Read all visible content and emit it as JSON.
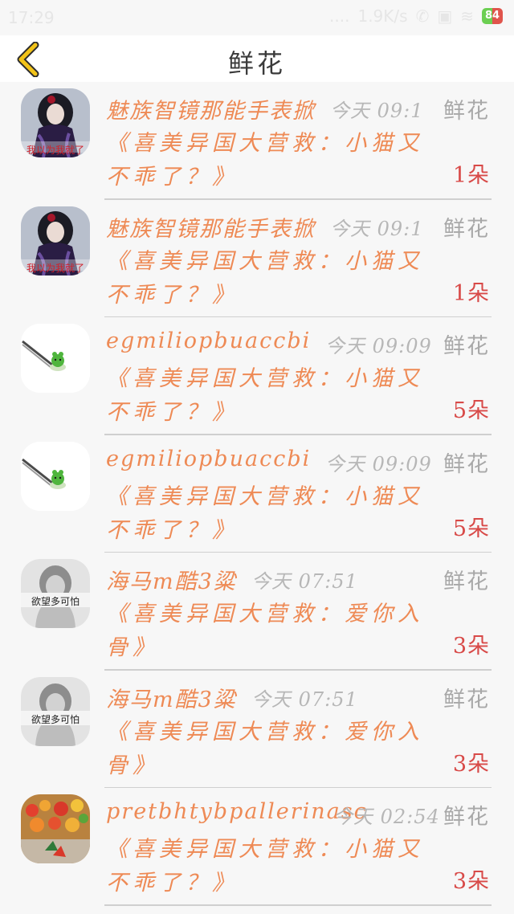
{
  "status_bar": {
    "time": "17:29",
    "signal": "....",
    "network": "1.9K/s",
    "battery": "84"
  },
  "nav": {
    "title": "鲜花",
    "back_icon": "chevron-left-icon",
    "back_color": "#f2c318"
  },
  "items": [
    {
      "avatar": "gothic-girl",
      "avatar_caption": "我以为我就了",
      "name": "魅族智镜那能手表掀",
      "time": "今天 09:1",
      "tag": "鲜花",
      "message": "《喜美异国大营救：小猫又不乖了？》",
      "count": "1朵"
    },
    {
      "avatar": "gothic-girl",
      "avatar_caption": "我以为我就了",
      "name": "魅族智镜那能手表掀",
      "time": "今天 09:1",
      "tag": "鲜花",
      "message": "《喜美异国大营救：小猫又不乖了？》",
      "count": "1朵"
    },
    {
      "avatar": "green-creature",
      "avatar_caption": "",
      "name": "egmiliopbuaccbi",
      "time": "今天 09:09",
      "tag": "鲜花",
      "message": "《喜美异国大营救：小猫又不乖了？》",
      "count": "5朵"
    },
    {
      "avatar": "green-creature",
      "avatar_caption": "",
      "name": "egmiliopbuaccbi",
      "time": "今天 09:09",
      "tag": "鲜花",
      "message": "《喜美异国大营救：小猫又不乖了？》",
      "count": "5朵"
    },
    {
      "avatar": "sad-girl",
      "avatar_caption": "欲望多可怕",
      "name": "海马m酷3粱",
      "time": "今天 07:51",
      "tag": "鲜花",
      "message": "《喜美异国大营救：爱你入骨》",
      "count": "3朵"
    },
    {
      "avatar": "sad-girl",
      "avatar_caption": "欲望多可怕",
      "name": "海马m酷3粱",
      "time": "今天 07:51",
      "tag": "鲜花",
      "message": "《喜美异国大营救：爱你入骨》",
      "count": "3朵"
    },
    {
      "avatar": "food-pasta",
      "avatar_caption": "",
      "name": "pretbhtybpallerinasc",
      "time": "今天 02:54",
      "tag": "鲜花",
      "message": "《喜美异国大营救：小猫又不乖了？》",
      "count": "3朵"
    }
  ],
  "colors": {
    "name": "#ee8a55",
    "count": "#d84a48",
    "tag": "#a8a8a8",
    "time": "#b7b7b7"
  }
}
